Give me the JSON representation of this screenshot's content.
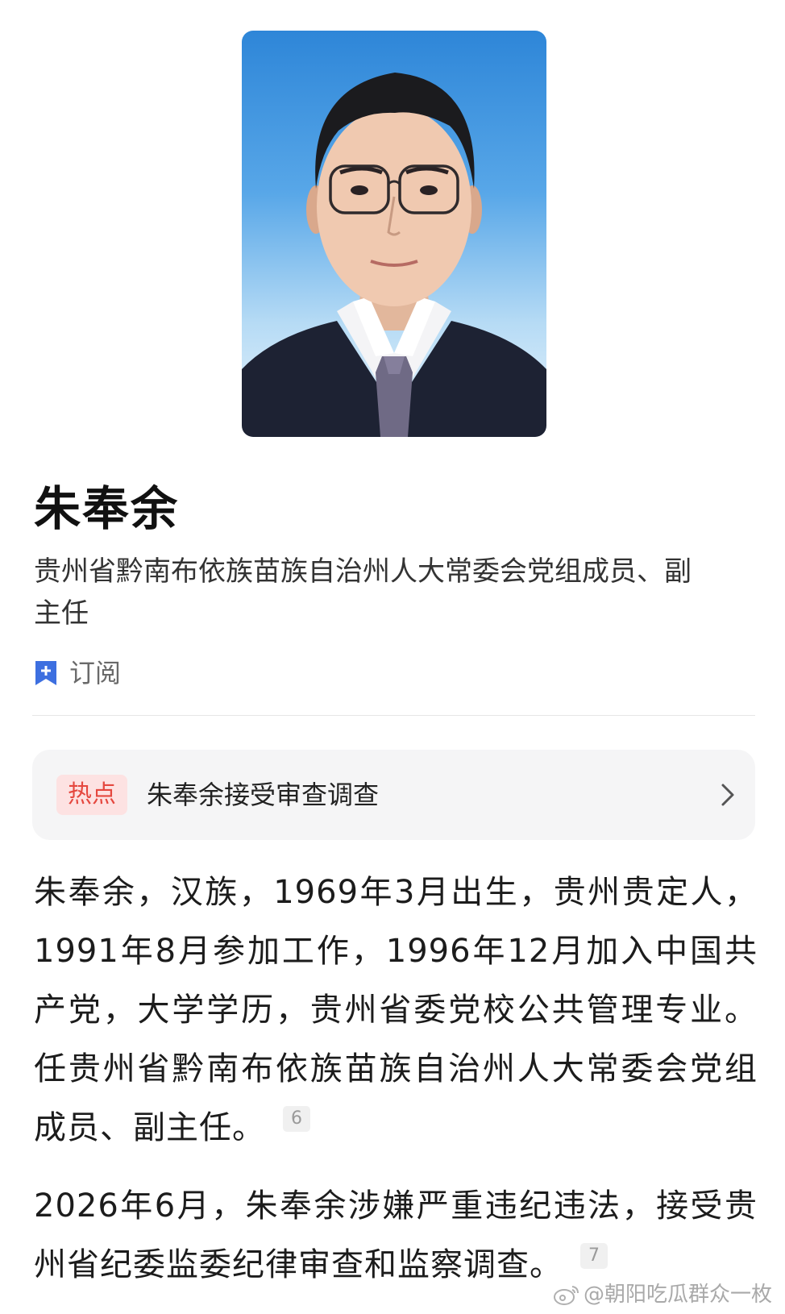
{
  "profile": {
    "name": "朱奉余",
    "title": "贵州省黔南布依族苗族自治州人大常委会党组成员、副主任",
    "subscribe_label": "订阅"
  },
  "hot": {
    "badge": "热点",
    "text": "朱奉余接受审查调查"
  },
  "paragraphs": [
    {
      "text": "朱奉余，汉族，1969年3月出生，贵州贵定人，1991年8月参加工作，1996年12月加入中国共产党，大学学历，贵州省委党校公共管理专业。任贵州省黔南布依族苗族自治州人大常委会党组成员、副主任。",
      "ref": "6"
    },
    {
      "text": "2026年6月，朱奉余涉嫌严重违纪违法，接受贵州省纪委监委纪律审查和监察调查。",
      "ref": "7"
    }
  ],
  "watermark": "@朝阳吃瓜群众一枚",
  "icons": {
    "subscribe": "bookmark-plus-icon",
    "chevron": "chevron-right-icon",
    "watermark": "weibo-logo-icon"
  },
  "colors": {
    "accent_blue": "#3d6fe0",
    "hot_red": "#e5483f",
    "hot_bg": "#fde2e2",
    "card_bg": "#f5f5f6"
  }
}
